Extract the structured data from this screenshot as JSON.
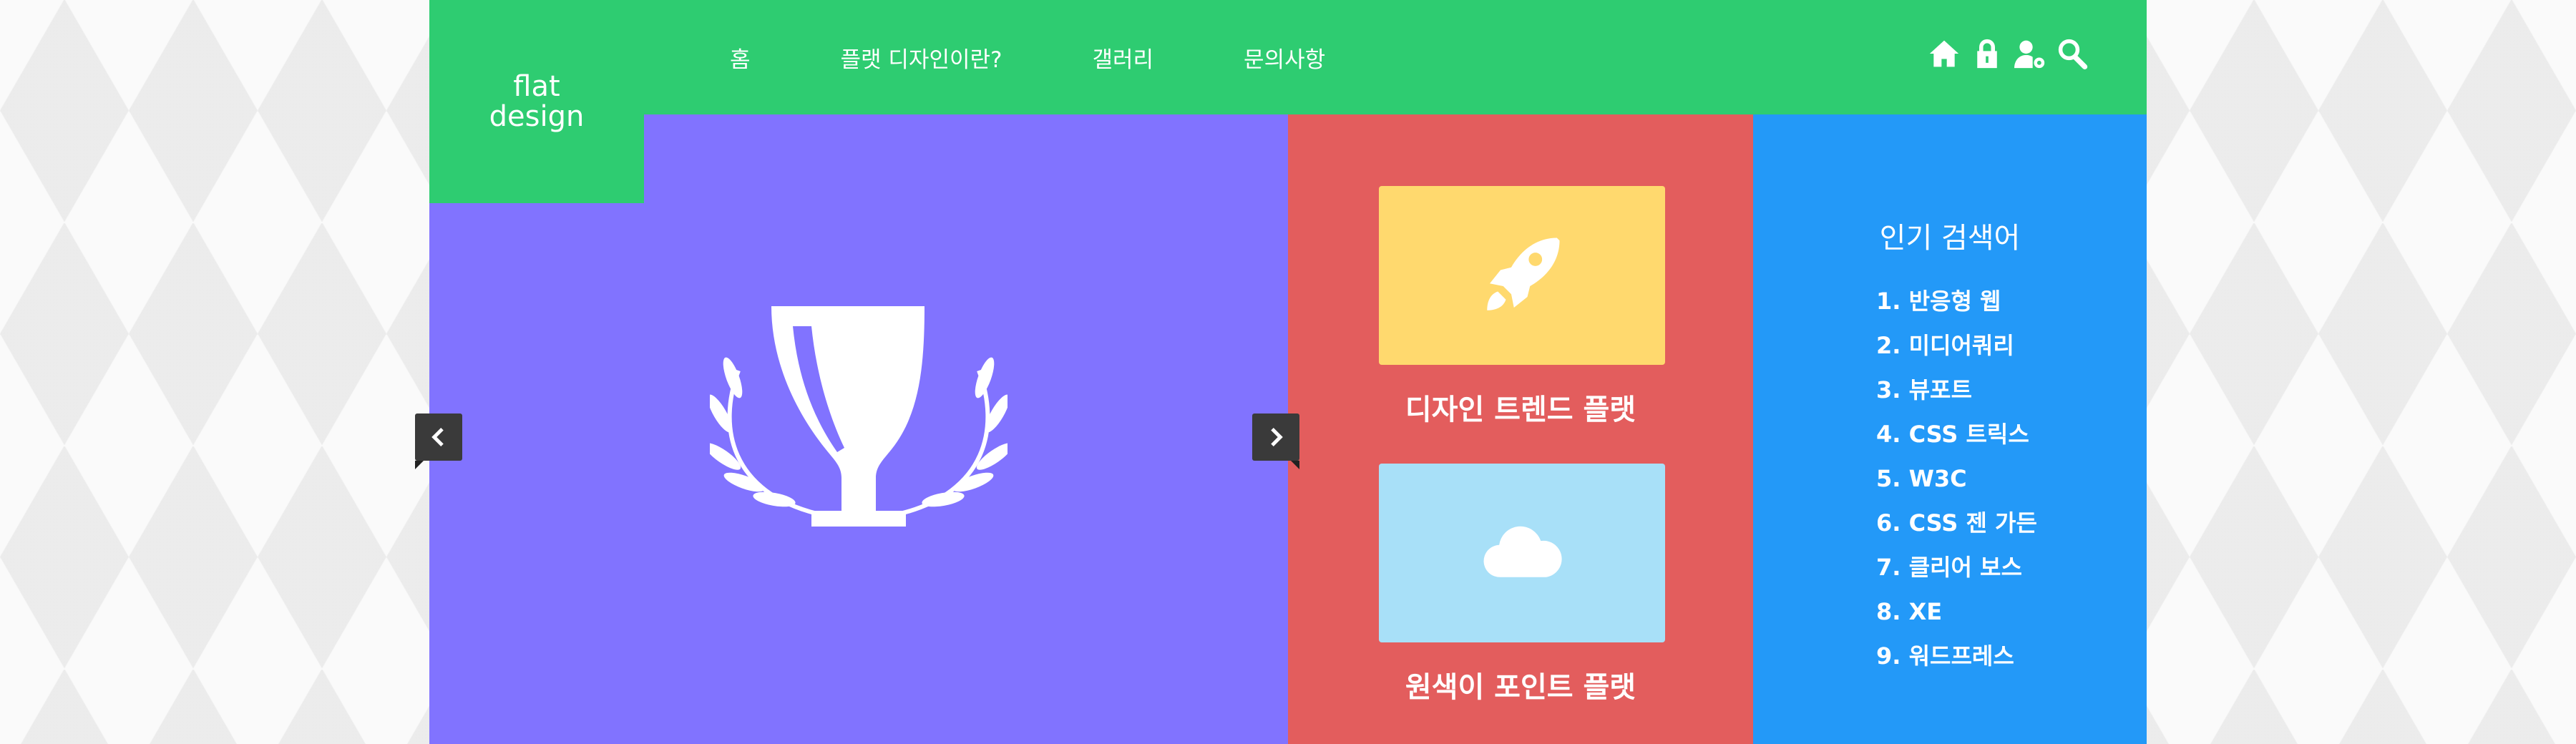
{
  "logo": {
    "line1": "flat",
    "line2": "design"
  },
  "nav": {
    "items": [
      {
        "label": "홈"
      },
      {
        "label": "플랫 디자인이란?"
      },
      {
        "label": "갤러리"
      },
      {
        "label": "문의사항"
      }
    ]
  },
  "tools": [
    "home-icon",
    "lock-icon",
    "user-settings-icon",
    "search-icon"
  ],
  "slider": {
    "image_icon": "trophy-icon"
  },
  "trends": {
    "cards": [
      {
        "label": "디자인 트렌드 플랫",
        "icon": "rocket-icon",
        "color": "#ffd96e"
      },
      {
        "label": "원색이 포인트 플랫",
        "icon": "cloud-icon",
        "color": "#a8e0f8"
      }
    ]
  },
  "popular": {
    "title": "인기 검색어",
    "items": [
      "1. 반응형 웹",
      "2. 미디어쿼리",
      "3. 뷰포트",
      "4. CSS 트릭스",
      "5. W3C",
      "6. CSS 젠 가든",
      "7. 클리어 보스",
      "8. XE",
      "9. 워드프레스"
    ]
  },
  "colors": {
    "header": "#2ecc71",
    "slider": "#8173ff",
    "trends": "#e35d5d",
    "popular": "#2399f8"
  }
}
